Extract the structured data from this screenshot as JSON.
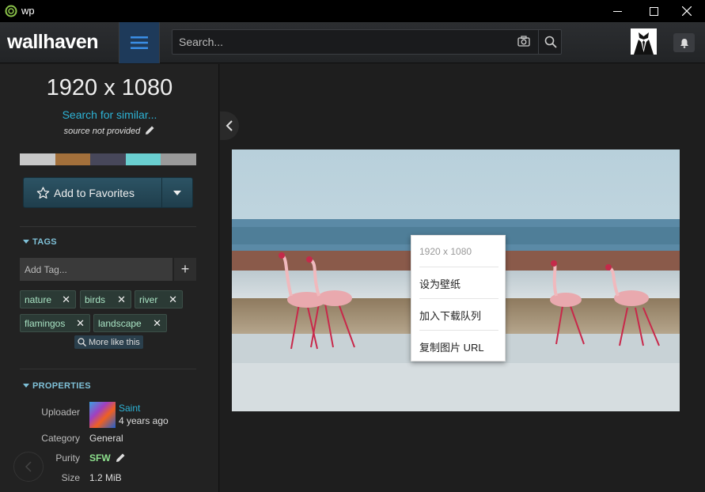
{
  "window": {
    "title": "wp",
    "controls": [
      "minimize",
      "maximize",
      "close"
    ]
  },
  "header": {
    "logo": "wallhaven",
    "search_placeholder": "Search..."
  },
  "sidebar": {
    "resolution": "1920 x 1080",
    "similar_link": "Search for similar...",
    "source": "source not provided",
    "palette": [
      "#c8c8c8",
      "#a3703b",
      "#47475a",
      "#6acfd0",
      "#9a9a9a"
    ],
    "favorites_label": "Add to Favorites",
    "tags_title": "TAGS",
    "tag_placeholder": "Add Tag...",
    "tag_add": "+",
    "tags": [
      "nature",
      "birds",
      "river",
      "flamingos",
      "landscape"
    ],
    "more_like_this": "More like this",
    "properties_title": "PROPERTIES",
    "properties": {
      "uploader_label": "Uploader",
      "uploader_name": "Saint",
      "uploader_time": "4 years ago",
      "category_label": "Category",
      "category_value": "General",
      "purity_label": "Purity",
      "purity_value": "SFW",
      "size_label": "Size",
      "size_value": "1.2 MiB"
    }
  },
  "context_menu": {
    "header": "1920 x 1080",
    "items": [
      "设为壁纸",
      "加入下载队列",
      "复制图片 URL"
    ]
  },
  "colors": {
    "accent": "#2db3d6",
    "section": "#7fc1d8",
    "tag_text": "#a9e4c4",
    "sfw": "#8de08d"
  }
}
